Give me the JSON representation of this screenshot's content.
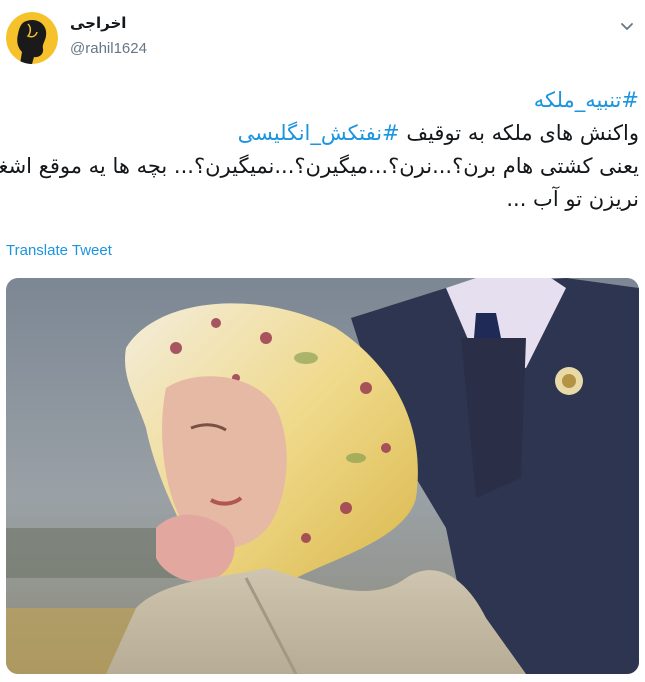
{
  "author": {
    "display_name": "اخراجی",
    "handle": "@rahil1624"
  },
  "tweet": {
    "hashtag1": "#تنبیه_ملکه",
    "line2_text": "واکنش های ملکه به توقیف ",
    "hashtag2": "#نفتکش_انگلیسی",
    "line3": "یعنی کشتی هام برن؟...نرن؟...میگیرن؟...نمیگیرن؟... بچه ها یه موقع اشغال",
    "line4": "نریزن تو آب ..."
  },
  "actions": {
    "translate": "Translate Tweet"
  },
  "icons": {
    "menu": "chevron-down-icon",
    "avatar": "silhouette-avatar"
  },
  "colors": {
    "link": "#1b95e0",
    "avatar_bg": "#f6c22b",
    "text": "#14171a",
    "secondary": "#657786"
  }
}
